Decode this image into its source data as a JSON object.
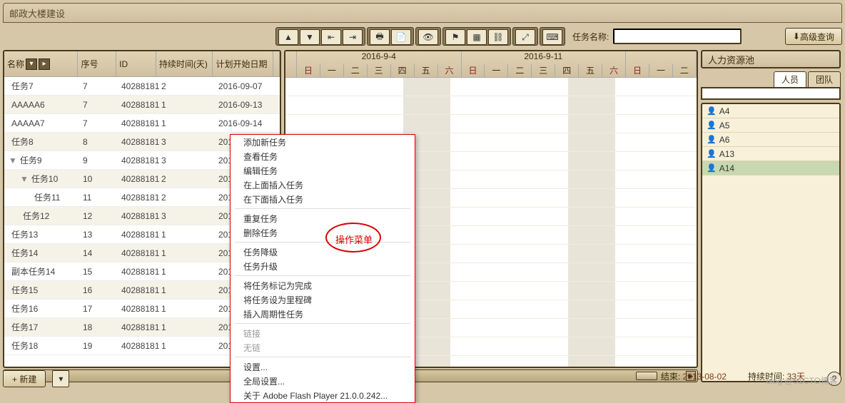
{
  "title": "邮政大楼建设",
  "toolbar": {
    "task_name_label": "任务名称:",
    "task_name_value": "",
    "adv_search": "高级查询"
  },
  "columns": {
    "name": "名称",
    "seq": "序号",
    "id": "ID",
    "dur": "持续时间(天)",
    "date": "计划开始日期"
  },
  "rows": [
    {
      "name": "任务7",
      "indent": 0,
      "expand": "",
      "seq": "7",
      "id": "40288181",
      "dur": "2",
      "date": "2016-09-07"
    },
    {
      "name": "AAAAA6",
      "indent": 0,
      "expand": "",
      "seq": "7",
      "id": "40288181",
      "dur": "1",
      "date": "2016-09-13"
    },
    {
      "name": "AAAAA7",
      "indent": 0,
      "expand": "",
      "seq": "7",
      "id": "40288181",
      "dur": "1",
      "date": "2016-09-14"
    },
    {
      "name": "任务8",
      "indent": 0,
      "expand": "",
      "seq": "8",
      "id": "40288181",
      "dur": "3",
      "date": "2016-09-07"
    },
    {
      "name": "任务9",
      "indent": 0,
      "expand": "▼",
      "seq": "9",
      "id": "40288181",
      "dur": "3",
      "date": "201"
    },
    {
      "name": "任务10",
      "indent": 1,
      "expand": "▼",
      "seq": "10",
      "id": "40288181",
      "dur": "2",
      "date": "201"
    },
    {
      "name": "任务11",
      "indent": 2,
      "expand": "",
      "seq": "11",
      "id": "40288181",
      "dur": "2",
      "date": "201"
    },
    {
      "name": "任务12",
      "indent": 1,
      "expand": "",
      "seq": "12",
      "id": "40288181",
      "dur": "3",
      "date": "201"
    },
    {
      "name": "任务13",
      "indent": 0,
      "expand": "",
      "seq": "13",
      "id": "40288181",
      "dur": "1",
      "date": "201"
    },
    {
      "name": "任务14",
      "indent": 0,
      "expand": "",
      "seq": "14",
      "id": "40288181",
      "dur": "1",
      "date": "201"
    },
    {
      "name": "副本任务14",
      "indent": 0,
      "expand": "",
      "seq": "15",
      "id": "40288181",
      "dur": "1",
      "date": "201"
    },
    {
      "name": "任务15",
      "indent": 0,
      "expand": "",
      "seq": "16",
      "id": "40288181",
      "dur": "1",
      "date": "201"
    },
    {
      "name": "任务16",
      "indent": 0,
      "expand": "",
      "seq": "17",
      "id": "40288181",
      "dur": "1",
      "date": "201"
    },
    {
      "name": "任务17",
      "indent": 0,
      "expand": "",
      "seq": "18",
      "id": "40288181",
      "dur": "1",
      "date": "201"
    },
    {
      "name": "任务18",
      "indent": 0,
      "expand": "",
      "seq": "19",
      "id": "40288181",
      "dur": "1",
      "date": "201"
    }
  ],
  "gantt": {
    "weeks": [
      "2016-9-4",
      "2016-9-11",
      ""
    ],
    "days": [
      "日",
      "一",
      "二",
      "三",
      "四",
      "五",
      "六",
      "日",
      "一",
      "二",
      "三",
      "四",
      "五",
      "六",
      "日",
      "一",
      "二"
    ]
  },
  "context_menu": {
    "annotation": "操作菜单",
    "items": [
      {
        "label": "添加新任务",
        "enabled": true
      },
      {
        "label": "查看任务",
        "enabled": true
      },
      {
        "label": "编辑任务",
        "enabled": true
      },
      {
        "label": "在上面插入任务",
        "enabled": true
      },
      {
        "label": "在下面插入任务",
        "enabled": true
      },
      {
        "sep": true
      },
      {
        "label": "重复任务",
        "enabled": true
      },
      {
        "label": "删除任务",
        "enabled": true
      },
      {
        "sep": true
      },
      {
        "label": "任务降级",
        "enabled": true
      },
      {
        "label": "任务升级",
        "enabled": true
      },
      {
        "sep": true
      },
      {
        "label": "将任务标记为完成",
        "enabled": true
      },
      {
        "label": "将任务设为里程碑",
        "enabled": true
      },
      {
        "label": "插入周期性任务",
        "enabled": true
      },
      {
        "sep": true
      },
      {
        "label": "链接",
        "enabled": false
      },
      {
        "label": "无链",
        "enabled": false
      },
      {
        "sep": true
      },
      {
        "label": "设置...",
        "enabled": true
      },
      {
        "label": "全局设置...",
        "enabled": true
      },
      {
        "label": "关于 Adobe Flash Player 21.0.0.242...",
        "enabled": true
      }
    ]
  },
  "pool": {
    "title": "人力资源池",
    "tabs": [
      "人员",
      "团队"
    ],
    "items": [
      {
        "name": "A4"
      },
      {
        "name": "A5"
      },
      {
        "name": "A6"
      },
      {
        "name": "A13"
      },
      {
        "name": "A14",
        "selected": true
      }
    ]
  },
  "footer": {
    "new_btn": "+  新建",
    "end_label": "结束:",
    "end_value": "2013-08-02",
    "dur_label": "持续时间:",
    "dur_value": "33天"
  },
  "watermark": "blog @51CTO博客"
}
